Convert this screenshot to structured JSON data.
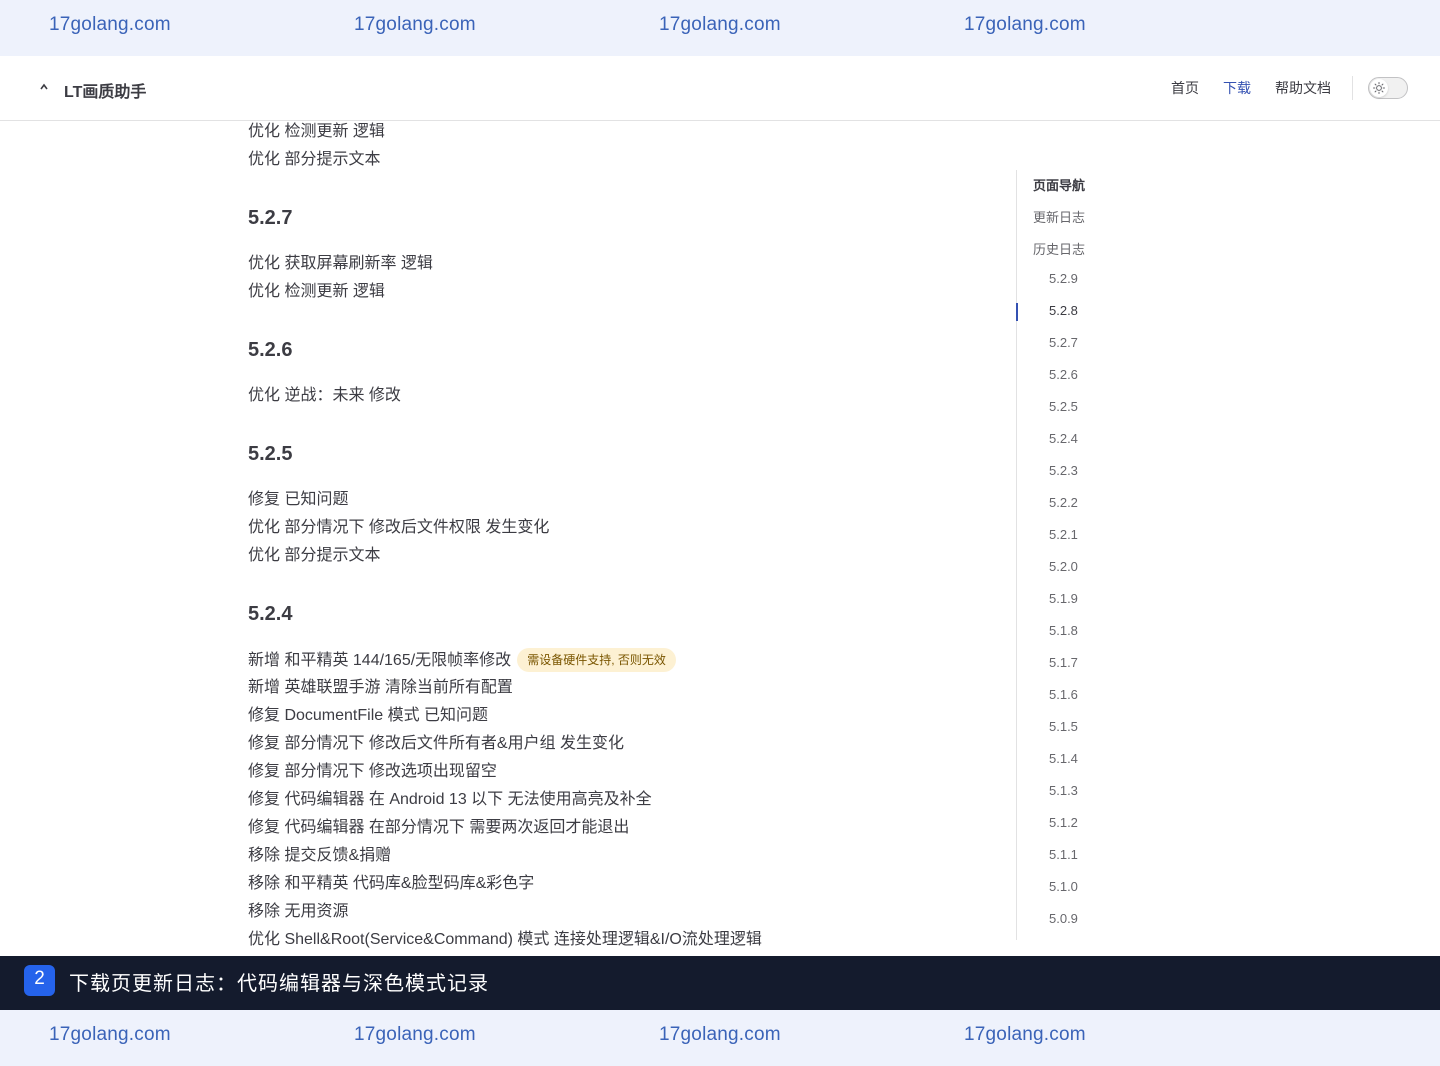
{
  "watermark": {
    "text": "17golang.com"
  },
  "navbar": {
    "title": "LT画质助手",
    "links": [
      "首页",
      "下载",
      "帮助文档"
    ],
    "active_link": "下载",
    "active_color": "#3451b2"
  },
  "content": {
    "lead_lines": [
      "优化 检测更新 逻辑",
      "优化 部分提示文本"
    ],
    "versions": [
      {
        "version": "5.2.7",
        "lines": [
          "优化 获取屏幕刷新率 逻辑",
          "优化 检测更新 逻辑"
        ]
      },
      {
        "version": "5.2.6",
        "lines": [
          "优化 逆战：未来 修改"
        ]
      },
      {
        "version": "5.2.5",
        "lines": [
          "修复 已知问题",
          "优化 部分情况下 修改后文件权限 发生变化",
          "优化 部分提示文本"
        ]
      },
      {
        "version": "5.2.4",
        "lines": [
          "新增 和平精英 144/165/无限帧率修改",
          "新增 英雄联盟手游 清除当前所有配置",
          "修复 DocumentFile 模式 已知问题",
          "修复 部分情况下 修改后文件所有者&用户组 发生变化",
          "修复 部分情况下 修改选项出现留空",
          "修复 代码编辑器 在 Android 13 以下 无法使用高亮及补全",
          "修复 代码编辑器 在部分情况下 需要两次返回才能退出",
          "移除 提交反馈&捐赠",
          "移除 和平精英 代码库&脸型码库&彩色字",
          "移除 无用资源",
          "优化 Shell&Root(Service&Command) 模式 连接处理逻辑&I/O流处理逻辑"
        ],
        "badge": "需设备硬件支持, 否则无效"
      }
    ]
  },
  "outline": {
    "title": "页面导航",
    "top_items": [
      "更新日志",
      "历史日志"
    ],
    "versions": [
      "5.2.9",
      "5.2.8",
      "5.2.7",
      "5.2.6",
      "5.2.5",
      "5.2.4",
      "5.2.3",
      "5.2.2",
      "5.2.1",
      "5.2.0",
      "5.1.9",
      "5.1.8",
      "5.1.7",
      "5.1.6",
      "5.1.5",
      "5.1.4",
      "5.1.3",
      "5.1.2",
      "5.1.1",
      "5.1.0",
      "5.0.9"
    ],
    "active": "5.2.8"
  },
  "caption": {
    "number": "2",
    "text": "下载页更新日志：代码编辑器与深色模式记录"
  }
}
